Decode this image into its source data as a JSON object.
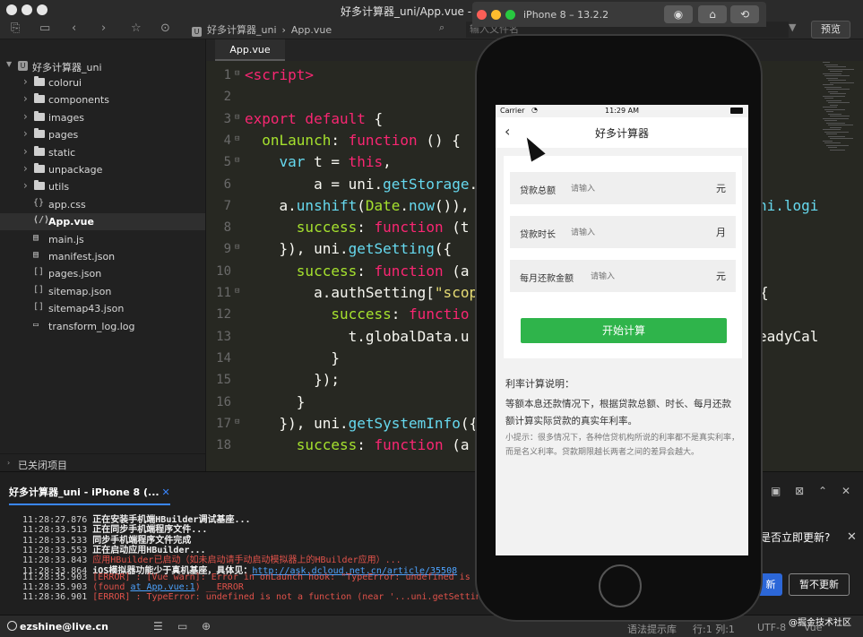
{
  "window": {
    "title": "好多计算器_uni/App.vue - HB"
  },
  "toolbar": {
    "breadcrumb": [
      "好多计算器_uni",
      "App.vue"
    ],
    "breadcrumb_sep": "›",
    "search_placeholder": "输入文件名",
    "preview_label": "预览"
  },
  "sidebar": {
    "project": "好多计算器_uni",
    "items": [
      {
        "label": "colorui",
        "type": "folder"
      },
      {
        "label": "components",
        "type": "folder"
      },
      {
        "label": "images",
        "type": "folder"
      },
      {
        "label": "pages",
        "type": "folder"
      },
      {
        "label": "static",
        "type": "folder"
      },
      {
        "label": "unpackage",
        "type": "folder"
      },
      {
        "label": "utils",
        "type": "folder"
      },
      {
        "label": "app.css",
        "type": "file",
        "icon": "{}"
      },
      {
        "label": "App.vue",
        "type": "file",
        "icon": "⟨/⟩",
        "selected": true
      },
      {
        "label": "main.js",
        "type": "file",
        "icon": "▤"
      },
      {
        "label": "manifest.json",
        "type": "file",
        "icon": "▤"
      },
      {
        "label": "pages.json",
        "type": "file",
        "icon": "[]"
      },
      {
        "label": "sitemap.json",
        "type": "file",
        "icon": "[]"
      },
      {
        "label": "sitemap43.json",
        "type": "file",
        "icon": "[]"
      },
      {
        "label": "transform_log.log",
        "type": "file",
        "icon": "▭"
      }
    ],
    "closed_items_label": "已关闭项目"
  },
  "editor": {
    "tab": "App.vue",
    "line_numbers": [
      "1",
      "2",
      "3",
      "4",
      "5",
      "6",
      "7",
      "8",
      "9",
      "10",
      "11",
      "12",
      "13",
      "14",
      "15",
      "16",
      "17",
      "18"
    ],
    "right_overflow": {
      "line7": "ni.logi",
      "line11": "{",
      "line13": "eadyCal"
    }
  },
  "console": {
    "tab_label": "好多计算器_uni - iPhone 8 (...",
    "tab_close": "✕",
    "logs": [
      {
        "time": "11:28:27.876",
        "msg": "正在安装手机端HBuilder调试基座...",
        "kind": "white"
      },
      {
        "time": "11:28:33.513",
        "msg": "正在同步手机端程序文件...",
        "kind": "white"
      },
      {
        "time": "11:28:33.533",
        "msg": "同步手机端程序文件完成",
        "kind": "white"
      },
      {
        "time": "11:28:33.553",
        "msg": "正在启动应用HBuilder...",
        "kind": "white"
      },
      {
        "time": "11:28:33.843",
        "msg": "应用HBuilder已启动（如未启动请手动启动模拟器上的HBuilder应用）...",
        "kind": "red"
      },
      {
        "time": "11:28:33.864",
        "msg": "iOS模拟器功能少于真机基座，具体见：",
        "link": "http://ask.dcloud.net.cn/article/35508",
        "kind": "white"
      },
      {
        "time": "11:28:35.903",
        "msg": "[ERROR] : [Vue warn]: Error in onLaunch hook: \"TypeError: undefined is no",
        "kind": "red"
      },
      {
        "time": "11:28:35.903",
        "msg": "(found ",
        "link": "at App.vue:1",
        "msg2": ")  __ERROR",
        "kind": "red"
      },
      {
        "time": "11:28:36.901",
        "msg": "[ERROR] : TypeError: undefined is not a function (near '...uni.getSetting...",
        "kind": "red"
      }
    ]
  },
  "update_dialog": {
    "question": "是否立即更新?",
    "update_now": "新",
    "later": "暂不更新"
  },
  "statusbar": {
    "user": "ezshine@live.cn",
    "syntax_hint": "语法提示库",
    "position": "行:1  列:1",
    "encoding": "UTF-8",
    "language": "Vue",
    "watermark": "@掘金技术社区"
  },
  "simulator": {
    "title": "iPhone 8 – 13.2.2",
    "status": {
      "carrier": "Carrier",
      "time": "11:29 AM"
    },
    "app": {
      "nav_title": "好多计算器",
      "fields": [
        {
          "label": "贷款总额",
          "placeholder": "请输入",
          "unit": "元"
        },
        {
          "label": "贷款时长",
          "placeholder": "请输入",
          "unit": "月"
        },
        {
          "label": "每月还款金额",
          "placeholder": "请输入",
          "unit": "元"
        }
      ],
      "button": "开始计算",
      "desc_title": "利率计算说明：",
      "desc_body": "等额本息还款情况下，根据贷款总额、时长、每月还款额计算实际贷款的真实年利率。",
      "desc_tip": "小提示：很多情况下，各种信贷机构所说的利率都不是真实利率，而是名义利率。贷款期限越长两者之间的差异会越大。"
    }
  },
  "colors": {
    "accent_green": "#2fb44b",
    "link_blue": "#4da3ff",
    "error_red": "#e0524a",
    "button_blue": "#2c67d8"
  }
}
